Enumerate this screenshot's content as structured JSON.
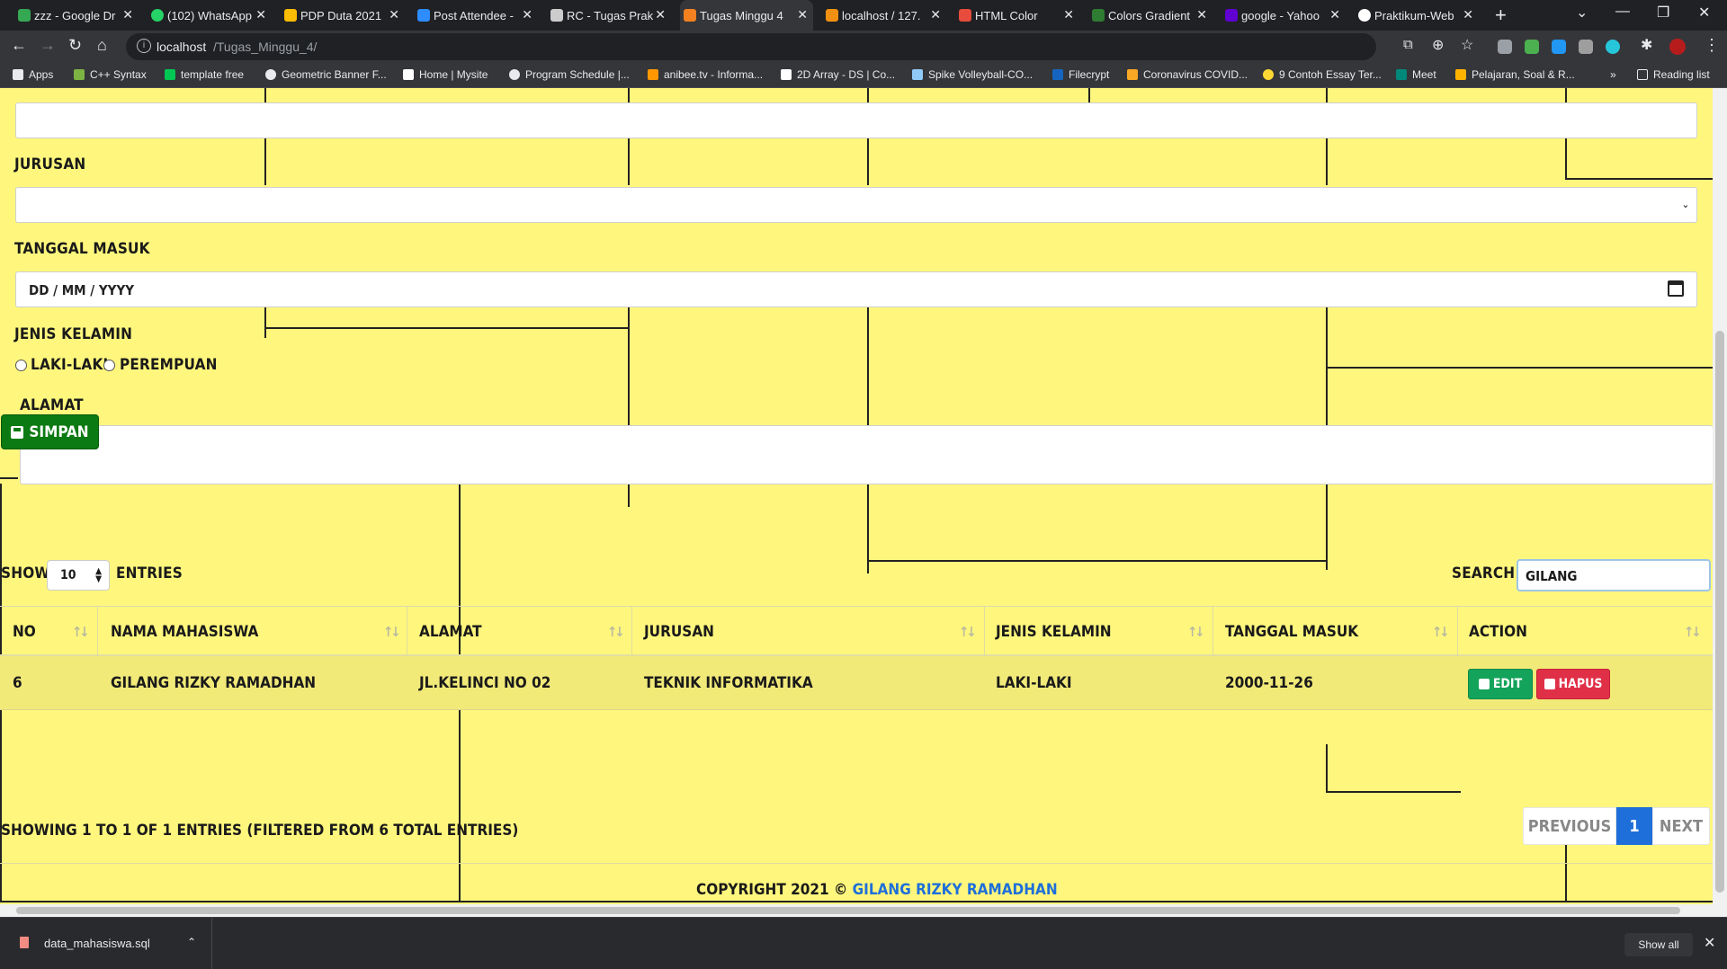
{
  "browser": {
    "tabs": [
      {
        "label": "zzz - Google Dr",
        "color": "#34a853"
      },
      {
        "label": "(102) WhatsApp",
        "color": "#25d366"
      },
      {
        "label": "PDP Duta 2021",
        "color": "#fbbc04"
      },
      {
        "label": "Post Attendee -",
        "color": "#2d8cff"
      },
      {
        "label": "RC - Tugas Prak",
        "color": "#cccccc"
      },
      {
        "label": "Tugas Minggu 4",
        "color": "#f48120"
      },
      {
        "label": "localhost / 127.",
        "color": "#f29111"
      },
      {
        "label": "HTML Color",
        "color": "#e74c3c"
      },
      {
        "label": "Colors Gradient",
        "color": "#2e7d32"
      },
      {
        "label": "google - Yahoo",
        "color": "#6001d2"
      },
      {
        "label": "Praktikum-Web",
        "color": "#ffffff"
      }
    ],
    "active_tab_index": 5,
    "url_host": "localhost",
    "url_path": "/Tugas_Minggu_4/",
    "bookmarks": [
      {
        "label": "Apps",
        "color": "#e8eaed"
      },
      {
        "label": "C++ Syntax",
        "color": "#7cb342"
      },
      {
        "label": "template free",
        "color": "#00c853"
      },
      {
        "label": "Geometric Banner F...",
        "color": "#e8eaed"
      },
      {
        "label": "Home | Mysite",
        "color": "#ffffff"
      },
      {
        "label": "Program Schedule |...",
        "color": "#e8eaed"
      },
      {
        "label": "anibee.tv - Informa...",
        "color": "#ff9800"
      },
      {
        "label": "2D Array - DS | Co...",
        "color": "#ffffff"
      },
      {
        "label": "Spike Volleyball-CO...",
        "color": "#90caf9"
      },
      {
        "label": "Filecrypt",
        "color": "#1565c0"
      },
      {
        "label": "Coronavirus COVID...",
        "color": "#f9a825"
      },
      {
        "label": "9 Contoh Essay Ter...",
        "color": "#fdd835"
      },
      {
        "label": "Meet",
        "color": "#00897b"
      },
      {
        "label": "Pelajaran, Soal & R...",
        "color": "#ffb300"
      }
    ],
    "bookmarks_more": "»",
    "reading_list": "Reading list"
  },
  "form": {
    "jurusan_label": "JURUSAN",
    "jurusan_value": "",
    "tanggal_label": "TANGGAL MASUK",
    "tanggal_placeholder": "DD / MM / YYYY",
    "jenis_kelamin_label": "JENIS KELAMIN",
    "gender_options": [
      "LAKI-LAKI",
      "PEREMPUAN"
    ],
    "alamat_label": "ALAMAT",
    "submit_label": "SIMPAN"
  },
  "table": {
    "show_label": "SHOW",
    "page_length": "10",
    "entries_label": "ENTRIES",
    "search_label": "SEARCH:",
    "search_value": "GILANG",
    "columns": [
      "NO",
      "NAMA MAHASISWA",
      "ALAMAT",
      "JURUSAN",
      "JENIS KELAMIN",
      "TANGGAL MASUK",
      "ACTION"
    ],
    "rows": [
      {
        "no": "6",
        "nama": "GILANG RIZKY RAMADHAN",
        "alamat": "JL.KELINCI NO 02",
        "jurusan": "TEKNIK INFORMATIKA",
        "jenis_kelamin": "LAKI-LAKI",
        "tanggal": "2000-11-26",
        "edit_label": "EDIT",
        "hapus_label": "HAPUS"
      }
    ],
    "info": "SHOWING 1 TO 1 OF 1 ENTRIES (FILTERED FROM 6 TOTAL ENTRIES)",
    "prev_label": "PREVIOUS",
    "current_page": "1",
    "next_label": "NEXT"
  },
  "footer": {
    "prefix": "COPYRIGHT 2021 © ",
    "author": "GILANG RIZKY RAMADHAN"
  },
  "downloads": {
    "filename": "data_mahasiswa.sql",
    "show_all": "Show all"
  }
}
